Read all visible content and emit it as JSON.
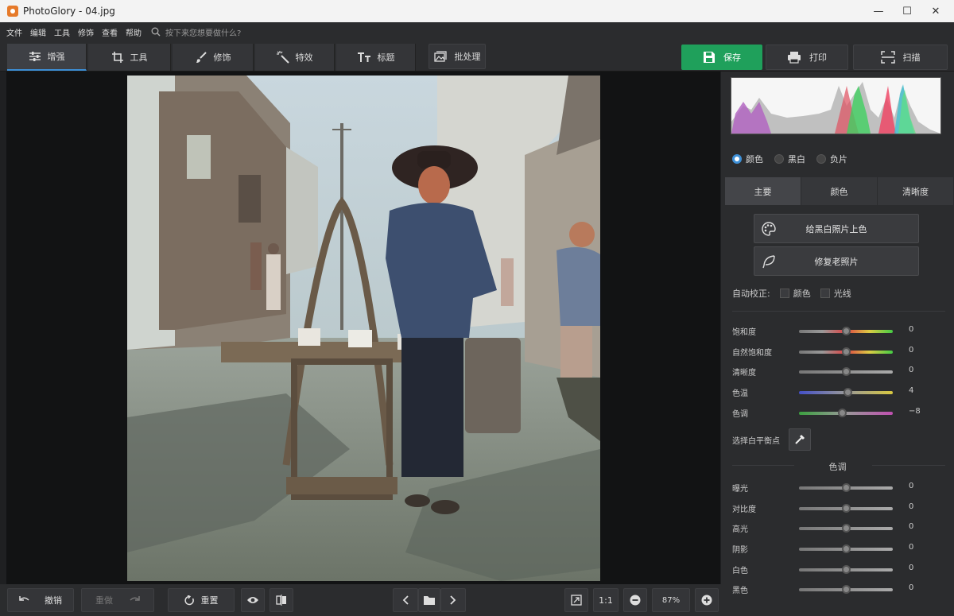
{
  "window": {
    "title": "PhotoGlory - 04.jpg",
    "minimize": "—",
    "maximize": "☐",
    "close": "✕"
  },
  "menu": {
    "items": [
      "文件",
      "编辑",
      "工具",
      "修饰",
      "查看",
      "帮助"
    ],
    "search_placeholder": "按下来您想要做什么?"
  },
  "tabs": [
    {
      "label": "增强",
      "icon": "sliders-icon"
    },
    {
      "label": "工具",
      "icon": "crop-icon"
    },
    {
      "label": "修饰",
      "icon": "brush-icon"
    },
    {
      "label": "特效",
      "icon": "magic-wand-icon"
    },
    {
      "label": "标题",
      "icon": "text-icon"
    }
  ],
  "toolbar": {
    "batch_label": "批处理",
    "save_label": "保存",
    "print_label": "打印",
    "scan_label": "扫描"
  },
  "right_panel": {
    "modes": [
      {
        "label": "颜色",
        "selected": true
      },
      {
        "label": "黑白",
        "selected": false
      },
      {
        "label": "负片",
        "selected": false
      }
    ],
    "tabs": [
      "主要",
      "颜色",
      "清晰度"
    ],
    "colorize_label": "给黑白照片上色",
    "restore_label": "修复老照片",
    "auto_correct": {
      "label": "自动校正:",
      "color": "颜色",
      "light": "光线"
    },
    "sliders_top": [
      {
        "label": "饱和度",
        "value": "0"
      },
      {
        "label": "自然饱和度",
        "value": "0"
      },
      {
        "label": "清晰度",
        "value": "0"
      },
      {
        "label": "色温",
        "value": "4"
      },
      {
        "label": "色调",
        "value": "−8"
      }
    ],
    "white_balance_label": "选择白平衡点",
    "tone_section": "色调",
    "sliders_bottom": [
      {
        "label": "曝光",
        "value": "0"
      },
      {
        "label": "对比度",
        "value": "0"
      },
      {
        "label": "高光",
        "value": "0"
      },
      {
        "label": "阴影",
        "value": "0"
      },
      {
        "label": "白色",
        "value": "0"
      },
      {
        "label": "黑色",
        "value": "0"
      }
    ]
  },
  "bottom": {
    "undo_label": "撤销",
    "redo_label": "重做",
    "reset_label": "重置",
    "ratio_label": "1:1",
    "zoom": "87%"
  },
  "colors": {
    "accent": "#3d8fd6",
    "save_green": "#1fa05b",
    "panel": "#2b2c2e",
    "canvas": "#121314"
  }
}
